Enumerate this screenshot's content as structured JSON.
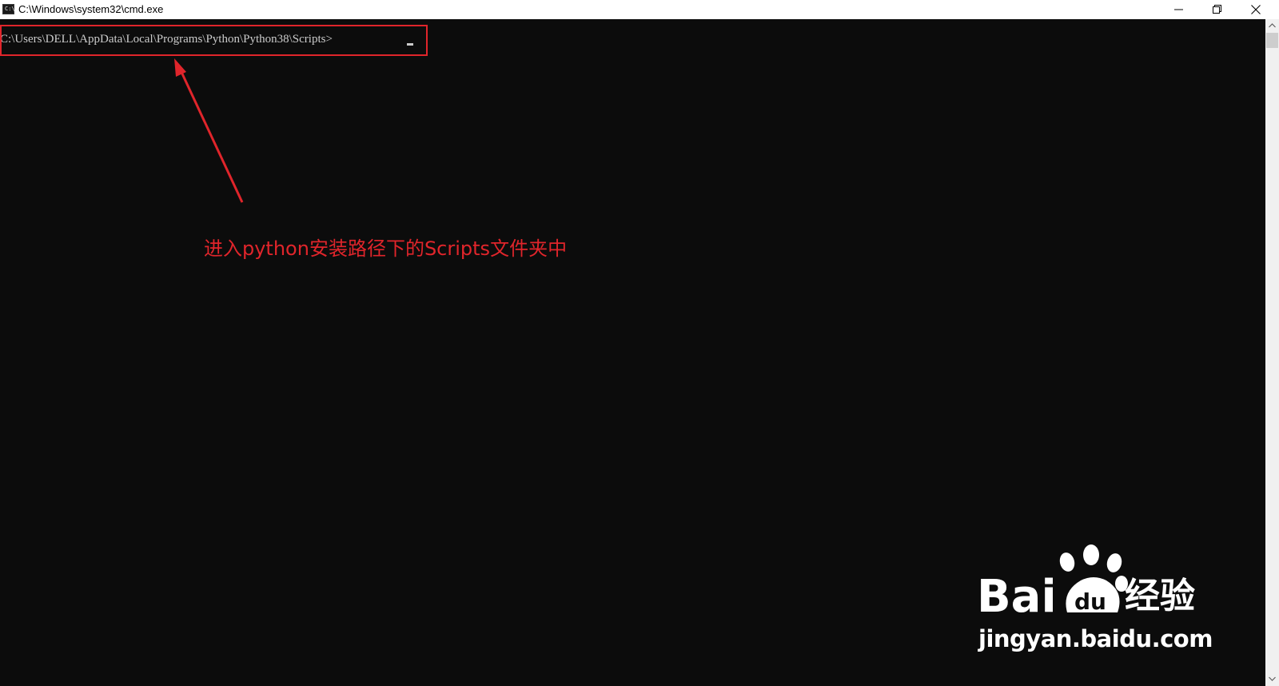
{
  "window": {
    "title": "C:\\Windows\\system32\\cmd.exe",
    "icon": "cmd-icon",
    "icon_glyph": "C:\\"
  },
  "console": {
    "prompt": "C:\\Users\\DELL\\AppData\\Local\\Programs\\Python\\Python38\\Scripts>",
    "background_color": "#0c0c0c",
    "text_color": "#cccccc"
  },
  "annotation": {
    "text": "进入python安装路径下的Scripts文件夹中",
    "color": "#e0252b"
  },
  "watermark": {
    "brand_latin": "Bai",
    "brand_du": "du",
    "brand_cn": "经验",
    "url": "jingyan.baidu.com"
  }
}
